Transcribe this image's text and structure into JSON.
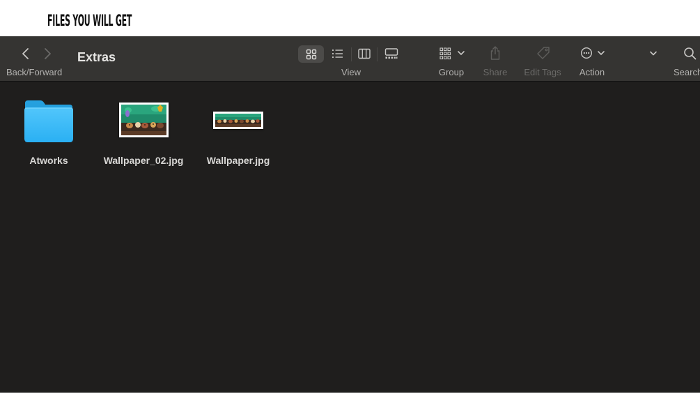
{
  "banner": {
    "title": "FILES YOU WILL GET"
  },
  "window": {
    "title": "Extras"
  },
  "toolbar": {
    "back_forward_label": "Back/Forward",
    "view_label": "View",
    "group_label": "Group",
    "share_label": "Share",
    "edit_tags_label": "Edit Tags",
    "action_label": "Action",
    "search_label": "Search"
  },
  "files": [
    {
      "name": "Atworks",
      "kind": "folder-icon"
    },
    {
      "name": "Wallpaper_02.jpg",
      "kind": "image-thumbnail"
    },
    {
      "name": "Wallpaper.jpg",
      "kind": "image-thumbnail"
    }
  ],
  "colors": {
    "window_bg": "#1f1e1d",
    "toolbar_bg": "#353432",
    "folder_blue": "#2fb3f5",
    "label_text": "#d9d8d6",
    "toolbar_text": "#b3b2b0",
    "disabled_text": "#6b6a68"
  }
}
